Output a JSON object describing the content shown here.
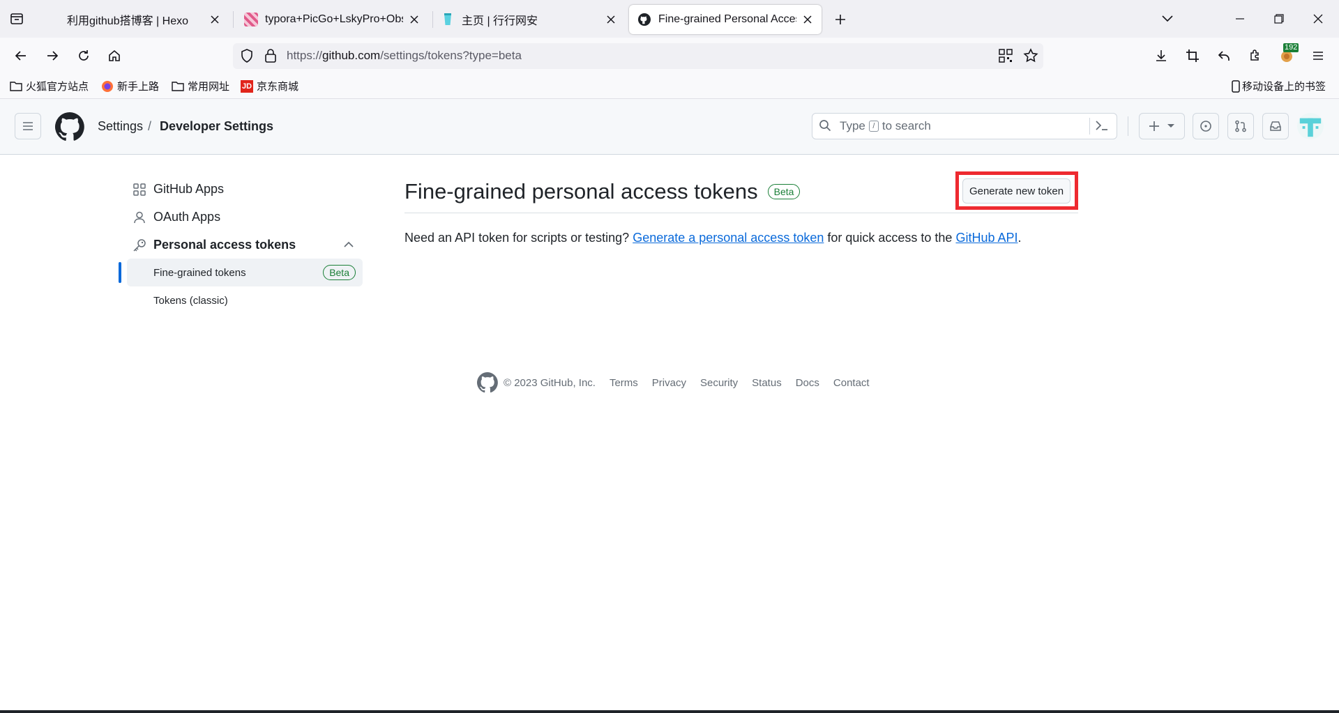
{
  "browser": {
    "tabs": [
      {
        "title": "利用github搭博客 | Hexo",
        "active": false
      },
      {
        "title": "typora+PicGo+LskyPro+Obsi",
        "active": false
      },
      {
        "title": "主页 | 行行网安",
        "active": false
      },
      {
        "title": "Fine-grained Personal Access",
        "active": true
      }
    ],
    "url_prefix": "https://",
    "url_domain": "github.com",
    "url_path": "/settings/tokens?type=beta",
    "extension_badge": "192",
    "bookmarks": [
      {
        "label": "火狐官方站点",
        "icon": "folder-icon"
      },
      {
        "label": "新手上路",
        "icon": "firefox-icon"
      },
      {
        "label": "常用网址",
        "icon": "folder-icon"
      },
      {
        "label": "京东商城",
        "icon": "jd-icon"
      }
    ],
    "mobile_bookmarks": "移动设备上的书签",
    "colors": {
      "chrome_bg": "#f0f0f4",
      "toolbar_bg": "#f9f9fb",
      "jd_red": "#e1251b"
    }
  },
  "github": {
    "breadcrumb_parent": "Settings",
    "breadcrumb_sep": "/",
    "breadcrumb_current": "Developer Settings",
    "search_prefix": "Type",
    "search_key": "/",
    "search_suffix": "to search",
    "sidebar": {
      "github_apps": "GitHub Apps",
      "oauth_apps": "OAuth Apps",
      "pat": "Personal access tokens",
      "fine_grained": "Fine-grained tokens",
      "fine_grained_badge": "Beta",
      "classic": "Tokens (classic)"
    },
    "main": {
      "title": "Fine-grained personal access tokens",
      "title_badge": "Beta",
      "generate_button": "Generate new token",
      "desc_1": "Need an API token for scripts or testing? ",
      "desc_link_1": "Generate a personal access token",
      "desc_2": " for quick access to the ",
      "desc_link_2": "GitHub API",
      "desc_3": "."
    },
    "footer": {
      "copyright": "© 2023 GitHub, Inc.",
      "links": [
        "Terms",
        "Privacy",
        "Security",
        "Status",
        "Docs",
        "Contact"
      ]
    },
    "colors": {
      "link": "#0969da",
      "badge_green": "#1a7f37",
      "highlight_box": "#ee2a30",
      "active_bar": "#0969da"
    }
  }
}
